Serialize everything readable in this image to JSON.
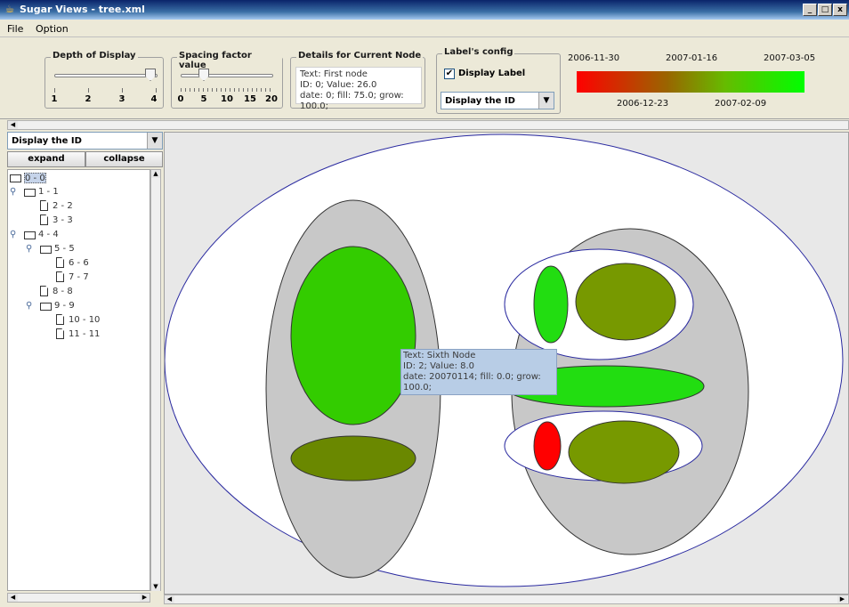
{
  "window": {
    "title": "Sugar Views - tree.xml",
    "app_icon": "java-cup-icon",
    "controls": [
      "_",
      "□",
      "x"
    ]
  },
  "menubar": {
    "items": [
      "File",
      "Option"
    ]
  },
  "toolbar": {
    "depth": {
      "title": "Depth of Display",
      "tick_labels": [
        "1",
        "2",
        "3",
        "4"
      ],
      "value": 4
    },
    "spacing": {
      "title": "Spacing factor value",
      "tick_labels": [
        "0",
        "5",
        "10",
        "15",
        "20"
      ],
      "value": 5
    },
    "details": {
      "title": "Details for Current Node",
      "lines": [
        "Text: First node",
        "ID: 0; Value: 26.0",
        "date: 0; fill: 75.0; grow: 100.0;"
      ]
    },
    "label_config": {
      "title": "Label's config",
      "display_label": "Display Label",
      "display_label_checked": true,
      "combo_value": "Display the ID"
    },
    "date_legend": {
      "top_labels": [
        "2006-11-30",
        "2007-01-16",
        "2007-03-05"
      ],
      "bottom_labels": [
        "2006-12-23",
        "2007-02-09"
      ],
      "colors": [
        "#ff0000",
        "#996600",
        "#66bb00",
        "#00ff00"
      ]
    }
  },
  "left_panel": {
    "combo_value": "Display the ID",
    "expand_label": "expand",
    "collapse_label": "collapse",
    "tree": [
      {
        "label": "0 - 0",
        "depth": 0,
        "type": "folder",
        "selected": true
      },
      {
        "label": "1 - 1",
        "depth": 1,
        "type": "folder"
      },
      {
        "label": "2 - 2",
        "depth": 2,
        "type": "leaf"
      },
      {
        "label": "3 - 3",
        "depth": 2,
        "type": "leaf"
      },
      {
        "label": "4 - 4",
        "depth": 1,
        "type": "folder"
      },
      {
        "label": "5 - 5",
        "depth": 2,
        "type": "folder"
      },
      {
        "label": "6 - 6",
        "depth": 3,
        "type": "leaf"
      },
      {
        "label": "7 - 7",
        "depth": 3,
        "type": "leaf"
      },
      {
        "label": "8 - 8",
        "depth": 2,
        "type": "leaf"
      },
      {
        "label": "9 - 9",
        "depth": 2,
        "type": "folder"
      },
      {
        "label": "10 - 10",
        "depth": 3,
        "type": "leaf"
      },
      {
        "label": "11 - 11",
        "depth": 3,
        "type": "leaf"
      }
    ]
  },
  "canvas": {
    "colors": {
      "root": "#ffffff",
      "group": "#c8c8c8",
      "inner": "#ffffff",
      "outline": "#2a2aa0",
      "green_bright": "#22dd11",
      "green_mid": "#33cc00",
      "olive": "#779900",
      "olive_dark": "#6a8800",
      "red": "#ff0000"
    },
    "tooltip": {
      "lines": [
        "Text: Sixth Node",
        "ID: 2; Value: 8.0",
        "date: 20070114; fill: 0.0; grow: 100.0;"
      ]
    }
  }
}
